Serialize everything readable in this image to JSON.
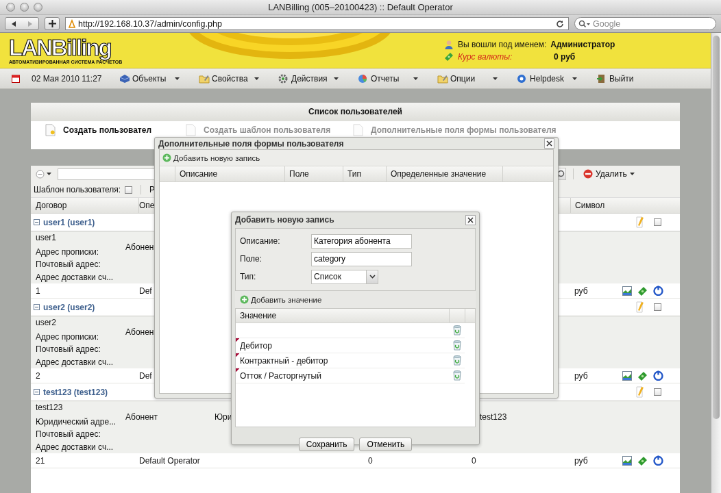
{
  "browser": {
    "title": "LANBilling (005–20100423) :: Default Operator",
    "url": "http://192.168.10.37/admin/config.php",
    "search_placeholder": "Google"
  },
  "header": {
    "logo": "LANBilling",
    "logo_subtitle": "АВТОМАТИЗИРОВАННАЯ СИСТЕМА РАСЧЕТОВ",
    "user_label": "Вы вошли под именем:",
    "user_name": "Администратор",
    "rate_label": "Курс валюты:",
    "rate_value": "0 руб"
  },
  "menu": {
    "datetime": "02 Мая 2010 11:27",
    "items": [
      {
        "label": "Объекты",
        "has_dropdown": true
      },
      {
        "label": "Свойства",
        "has_dropdown": true
      },
      {
        "label": "Действия",
        "has_dropdown": true
      },
      {
        "label": "Отчеты",
        "has_dropdown": true
      },
      {
        "label": "Опции",
        "has_dropdown": true
      },
      {
        "label": "Helpdesk",
        "has_dropdown": true
      },
      {
        "label": "Выйти",
        "has_dropdown": false
      }
    ]
  },
  "panel": {
    "title": "Список пользователей",
    "tabs": [
      {
        "label": "Создать пользовател",
        "disabled": false
      },
      {
        "label": "Создать шаблон пользователя",
        "disabled": true
      },
      {
        "label": "Дополнительные поля формы пользователя",
        "disabled": true
      }
    ]
  },
  "grid": {
    "delete_button": "Удалить",
    "template_label": "Шаблон пользователя:",
    "template_checked": false,
    "filter_label": "Р",
    "columns": [
      "Договор",
      "Опе",
      "Символ"
    ],
    "groups": [
      {
        "title": "user1 (user1)",
        "checked": false,
        "first_line": {
          "login": "user1",
          "type": "Абонен"
        },
        "lines": [
          "Адрес прописки:",
          "Почтовый адрес:",
          "Адрес доставки сч..."
        ],
        "summary": {
          "contract": "1",
          "operator": "Def",
          "symbol": "руб"
        }
      },
      {
        "title": "user2 (user2)",
        "checked": false,
        "first_line": {
          "login": "user2",
          "type": "Абонен"
        },
        "lines": [
          "Адрес прописки:",
          "Почтовый адрес:",
          "Адрес доставки сч..."
        ],
        "summary": {
          "contract": "2",
          "operator": "Def",
          "symbol": "руб"
        }
      },
      {
        "title": "test123 (test123)",
        "checked": false,
        "first_line": {
          "login": "test123",
          "type": "Абонент",
          "column_3": "Юри",
          "column_4": "test123"
        },
        "lines": [
          "Юридический адре...",
          "Почтовый адрес:",
          "Адрес доставки сч..."
        ],
        "summary": {
          "contract": "21",
          "operator": "Default Operator",
          "column_3": "0",
          "column_4": "0",
          "symbol": "руб"
        }
      }
    ]
  },
  "fields_dialog": {
    "title": "Дополнительные поля формы пользователя",
    "add_button": "Добавить новую запись",
    "columns": [
      "Описание",
      "Поле",
      "Тип",
      "Определенные значение"
    ]
  },
  "record_dialog": {
    "title": "Добавить новую запись",
    "fields": [
      {
        "label": "Описание:",
        "value": "Категория абонента",
        "kind": "text"
      },
      {
        "label": "Поле:",
        "value": "category",
        "kind": "text"
      },
      {
        "label": "Тип:",
        "value": "Список",
        "kind": "select"
      }
    ],
    "add_value_button": "Добавить значение",
    "values_column": "Значение",
    "values": [
      {
        "modified": false
      },
      {
        "value": "Дебитор",
        "modified": true
      },
      {
        "value": "Контрактный - дебитор",
        "modified": true
      },
      {
        "value": "Отток / Расторгнутый",
        "modified": true
      }
    ],
    "buttons": [
      "Сохранить",
      "Отменить"
    ]
  }
}
